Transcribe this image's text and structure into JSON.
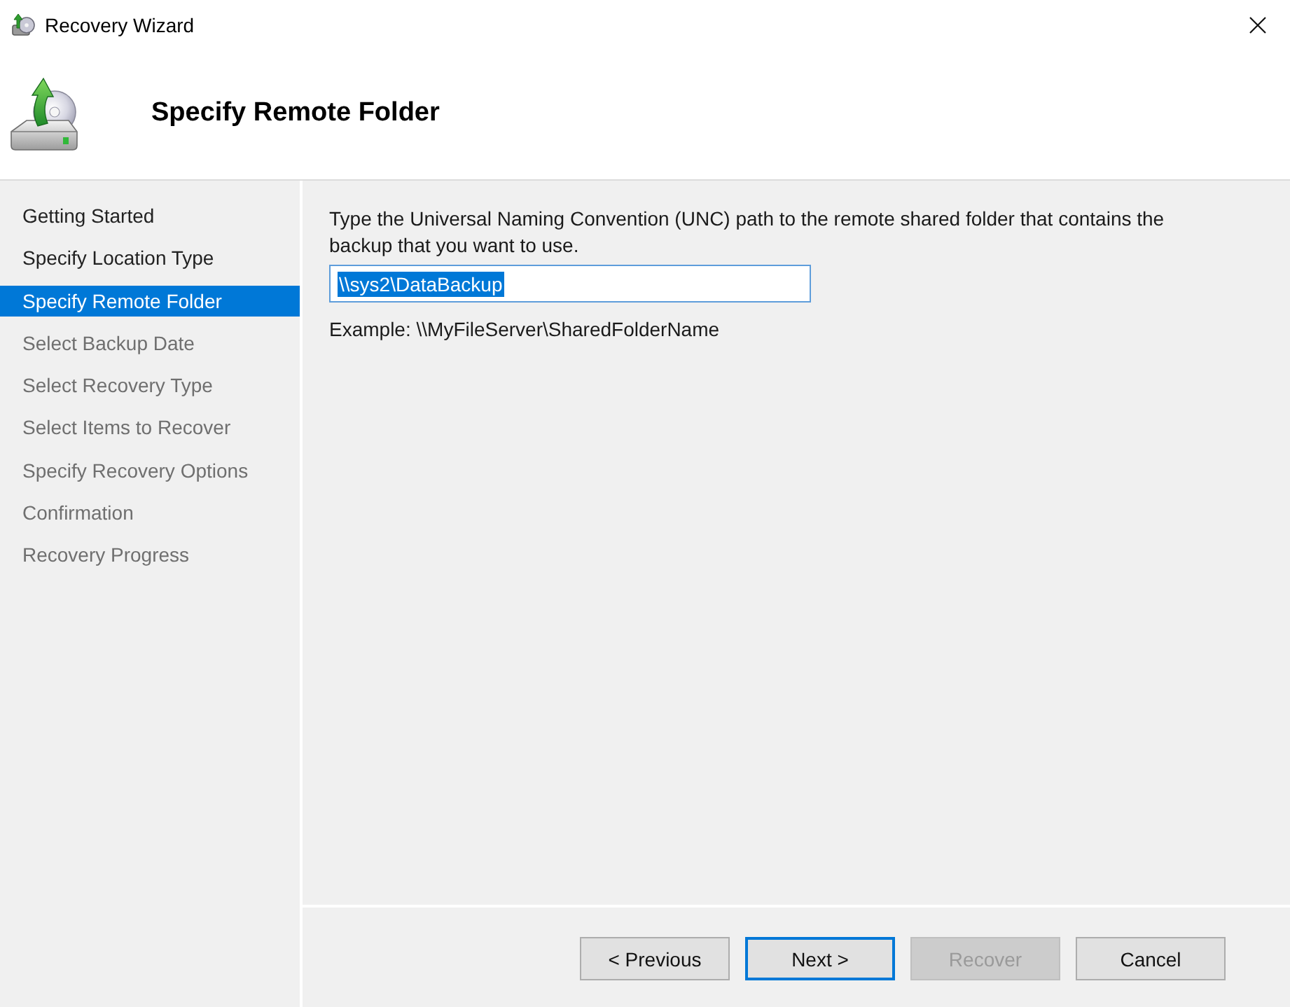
{
  "window": {
    "title": "Recovery Wizard"
  },
  "header": {
    "title": "Specify Remote Folder"
  },
  "steps": [
    {
      "label": "Getting Started",
      "selected": false,
      "disabled": false
    },
    {
      "label": "Specify Location Type",
      "selected": false,
      "disabled": false
    },
    {
      "label": "Specify Remote Folder",
      "selected": true,
      "disabled": false
    },
    {
      "label": "Select Backup Date",
      "selected": false,
      "disabled": true
    },
    {
      "label": "Select Recovery Type",
      "selected": false,
      "disabled": true
    },
    {
      "label": "Select Items to Recover",
      "selected": false,
      "disabled": true
    },
    {
      "label": "Specify Recovery Options",
      "selected": false,
      "disabled": true
    },
    {
      "label": "Confirmation",
      "selected": false,
      "disabled": true
    },
    {
      "label": "Recovery Progress",
      "selected": false,
      "disabled": true
    }
  ],
  "page": {
    "instruction": "Type the Universal Naming Convention (UNC) path to the remote shared folder that contains the backup that you want to use.",
    "path_field": {
      "value": "\\\\sys2\\DataBackup",
      "text_selected": true
    },
    "example": "Example: \\\\MyFileServer\\SharedFolderName"
  },
  "buttons": [
    {
      "label": "< Previous",
      "default": false,
      "disabled": false
    },
    {
      "label": "Next >",
      "default": true,
      "disabled": false
    },
    {
      "label": "Recover",
      "default": false,
      "disabled": true
    },
    {
      "label": "Cancel",
      "default": false,
      "disabled": false
    }
  ]
}
